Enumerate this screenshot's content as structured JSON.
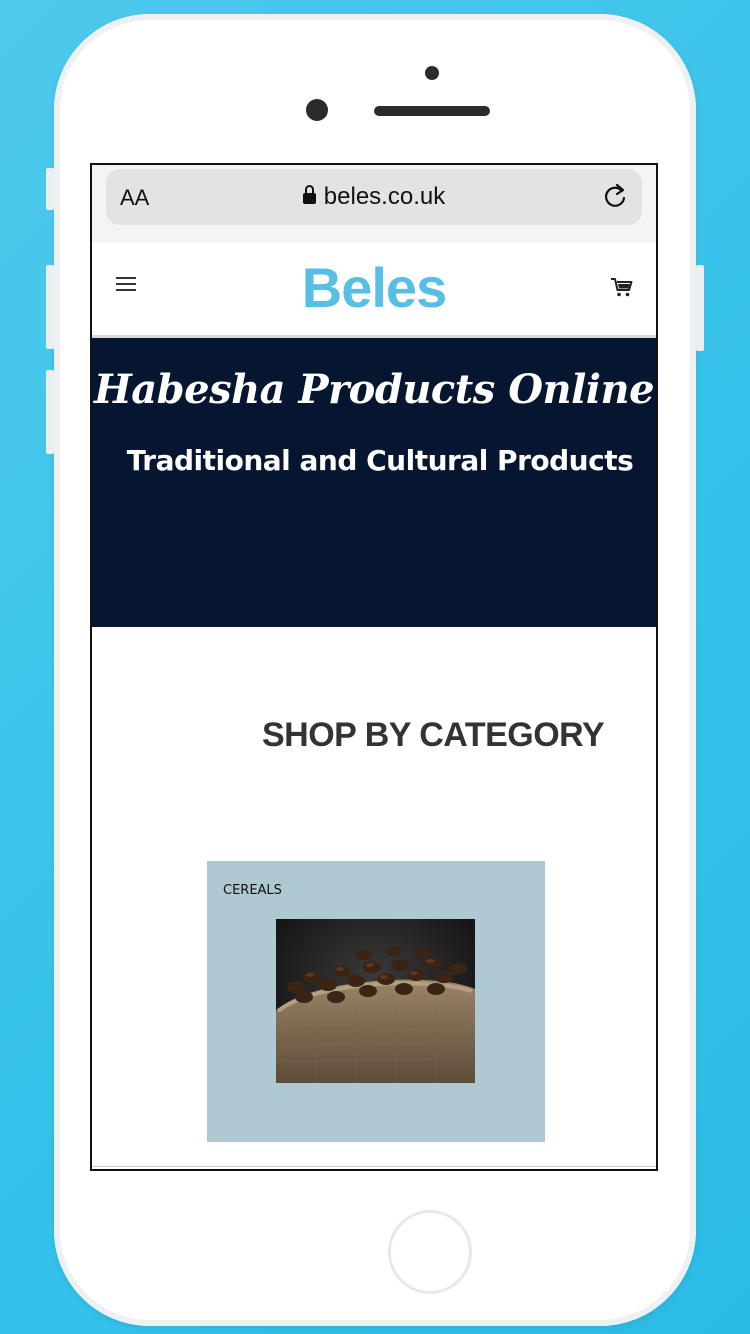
{
  "browser": {
    "text_size_label": "AA",
    "url": "beles.co.uk"
  },
  "site": {
    "brand": "Beles"
  },
  "hero": {
    "title": "Habesha Products Online",
    "subtitle": "Traditional and Cultural Products"
  },
  "categories": {
    "heading": "SHOP BY CATEGORY",
    "items": [
      {
        "label": "CEREALS"
      }
    ]
  },
  "colors": {
    "background": "#36c2ea",
    "brand": "#57bfe6",
    "hero_bg": "#061630",
    "card_bg": "#aec9d1"
  },
  "icons": [
    "lock-icon",
    "reload-icon",
    "menu-icon",
    "cart-icon"
  ]
}
